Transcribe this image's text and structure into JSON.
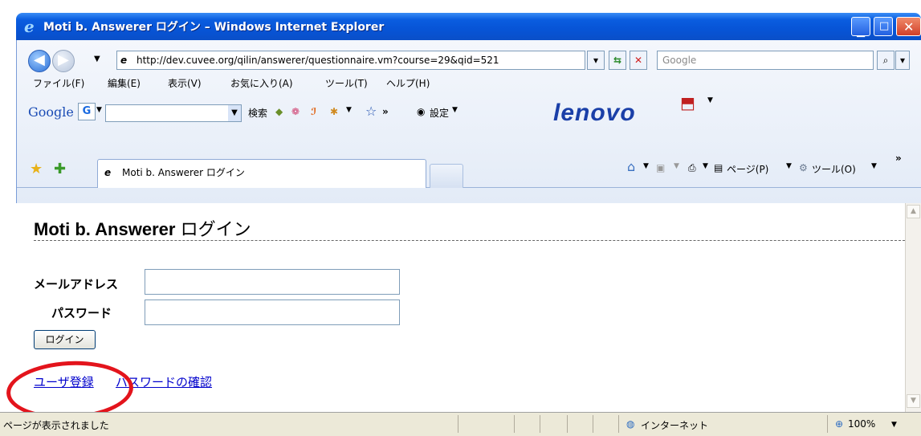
{
  "window": {
    "title": "Moti b. Answerer ログイン – Windows Internet Explorer"
  },
  "address": {
    "url": "http://dev.cuvee.org/qilin/answerer/questionnaire.vm?course=29&qid=521",
    "search_placeholder": "Google"
  },
  "menu": [
    "ファイル(F)",
    "編集(E)",
    "表示(V)",
    "お気に入り(A)",
    "ツール(T)",
    "ヘルプ(H)"
  ],
  "google_toolbar": {
    "logo": "Google",
    "logo_g": "G",
    "search_label": "検索",
    "settings_label": "設定",
    "brand": "lenovo"
  },
  "tabs": {
    "active_tab": "Moti b. Answerer ログイン",
    "page_menu": "ページ(P)",
    "tools_menu": "ツール(O)"
  },
  "page": {
    "title_bold": "Moti b. Answerer",
    "title_rest": "ログイン",
    "email_label": "メールアドレス",
    "password_label": "パスワード",
    "email_value": "",
    "password_value": "",
    "login_button": "ログイン",
    "register_link": "ユーザ登録",
    "password_link": "パスワードの確認"
  },
  "status_bar": {
    "message": "ページが表示されました",
    "zone": "インターネット",
    "zoom": "100%"
  },
  "colors": {
    "titlebar": "#0754d6",
    "link": "#0000cc",
    "annotation_circle": "#e3141c"
  }
}
